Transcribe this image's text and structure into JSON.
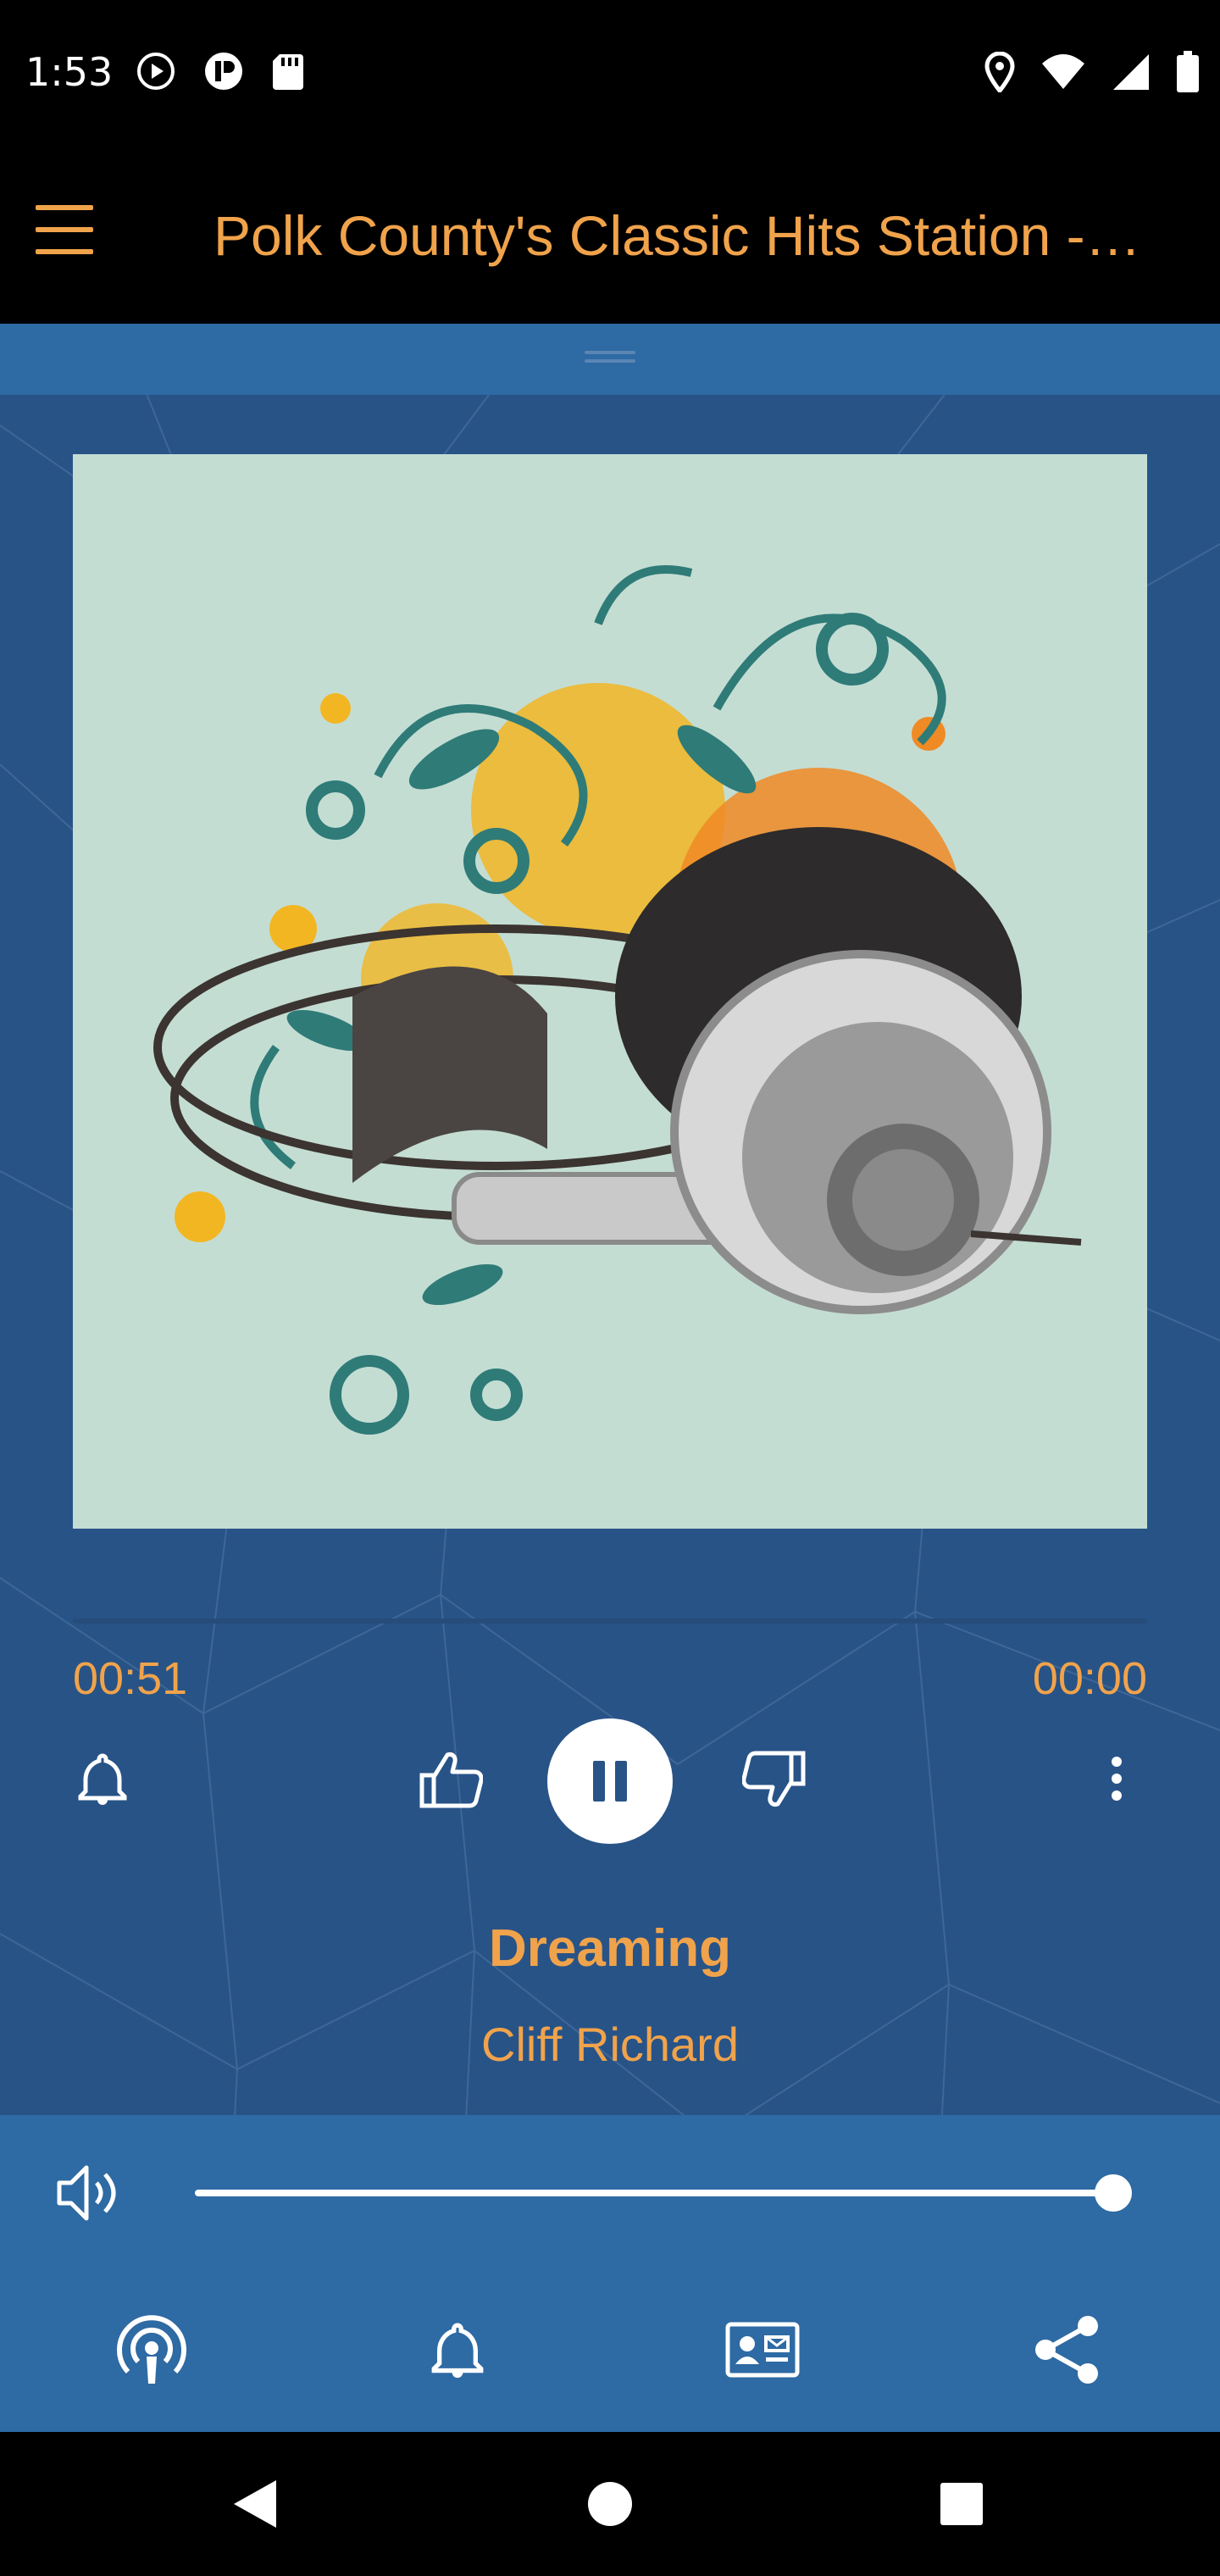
{
  "status_bar": {
    "time": "1:53",
    "left_icons": [
      "play-circle-icon",
      "media-icon",
      "sd-card-icon"
    ],
    "right_icons": [
      "location-icon",
      "wifi-icon",
      "signal-icon",
      "battery-icon"
    ]
  },
  "app_bar": {
    "title": "Polk County's Classic Hits Station -…",
    "menu_icon": "hamburger-menu-icon"
  },
  "player": {
    "artwork_icon": "headphones-artwork",
    "progress": 0.0,
    "elapsed": "00:51",
    "total": "00:00",
    "song_title": "Dreaming",
    "artist": "Cliff Richard",
    "controls": [
      "alarm-icon",
      "thumbs-up-icon",
      "pause-icon",
      "thumbs-down-icon",
      "more-vert-icon"
    ]
  },
  "volume": {
    "icon": "volume-icon",
    "level": 1.0
  },
  "bottom_bar": {
    "icons": [
      "podcast-icon",
      "notification-bell-icon",
      "contact-card-icon",
      "share-icon"
    ]
  },
  "nav_bar": {
    "icons": [
      "back-icon",
      "home-icon",
      "recents-icon"
    ]
  },
  "colors": {
    "accent": "#f0a34b",
    "background": "#285387",
    "panel": "#2e6aa3",
    "bar": "#000000"
  }
}
